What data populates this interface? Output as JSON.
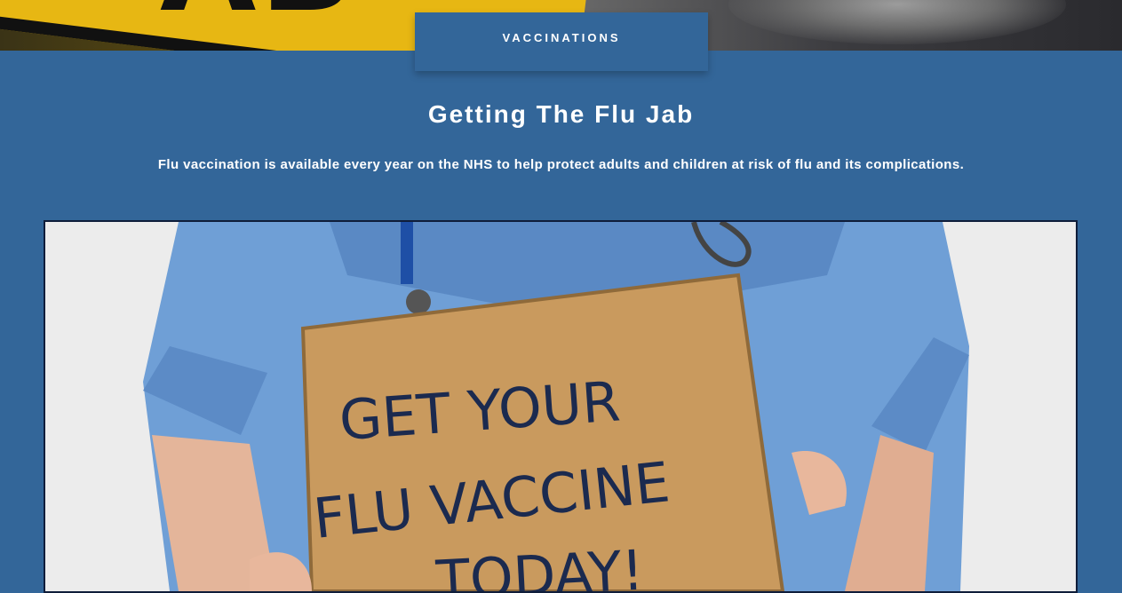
{
  "section_tab": {
    "label": "VACCINATIONS"
  },
  "heading": "Getting The Flu Jab",
  "lead_text": "Flu vaccination is available every year on the NHS to help protect adults and children at risk of flu and its complications.",
  "image": {
    "sign_line1": "GET YOUR",
    "sign_line2": "FLU VACCINE",
    "sign_line3": "TODAY!"
  },
  "colors": {
    "section_background": "#336699",
    "tab_background": "#336699",
    "text": "#ffffff"
  }
}
